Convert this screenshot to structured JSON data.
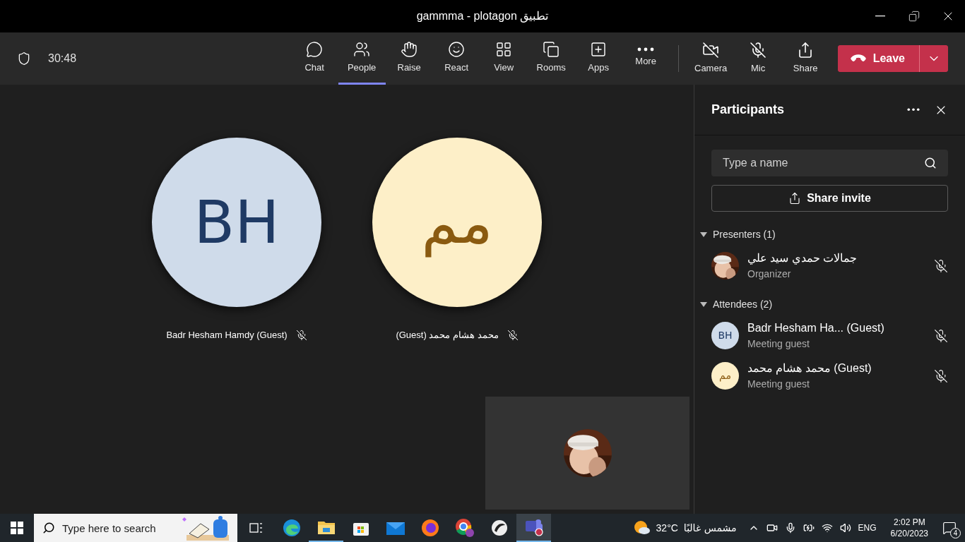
{
  "window": {
    "title": "gammma - plotagon تطبيق"
  },
  "meeting_bar": {
    "timer": "30:48",
    "items": [
      {
        "label": "Chat",
        "selected": false
      },
      {
        "label": "People",
        "selected": true
      },
      {
        "label": "Raise",
        "selected": false
      },
      {
        "label": "React",
        "selected": false
      },
      {
        "label": "View",
        "selected": false
      },
      {
        "label": "Rooms",
        "selected": false
      },
      {
        "label": "Apps",
        "selected": false
      },
      {
        "label": "More",
        "selected": false
      }
    ],
    "devices": [
      {
        "label": "Camera"
      },
      {
        "label": "Mic"
      },
      {
        "label": "Share"
      }
    ],
    "leave_button": "Leave"
  },
  "stage": {
    "tiles": [
      {
        "initials": "BH",
        "name": "Badr Hesham Hamdy (Guest)",
        "color": "#cfdbea"
      },
      {
        "initials": "مم",
        "name": "(Guest) محمد هشام محمد",
        "color": "#fdefc8"
      }
    ]
  },
  "participants_panel": {
    "title": "Participants",
    "search": {
      "placeholder": "Type a name"
    },
    "share_button": "Share invite",
    "groups": [
      {
        "title": "Presenters (1)",
        "expanded": true,
        "people": [
          {
            "kind": "picture",
            "name": "جمالات حمدي سيد علي",
            "role": "Organizer"
          }
        ]
      },
      {
        "title": "Attendees (2)",
        "expanded": true,
        "people": [
          {
            "kind": "initials",
            "initials": "BH",
            "color": "#cfdbea",
            "name": "Badr Hesham Ha... (Guest)",
            "role": "Meeting guest"
          },
          {
            "kind": "initials",
            "initials": "مم",
            "color": "#fdefc8",
            "name": "محمد هشام محمد (Guest)",
            "role": "Meeting guest"
          }
        ]
      }
    ]
  },
  "taskbar": {
    "search": {
      "placeholder": "Type here to search"
    },
    "weather": {
      "temperature": "32°C",
      "condition": "مشمس غالبًا"
    },
    "language": "ENG",
    "time": "2:02 PM",
    "date": "6/20/2023",
    "notification_count": "4"
  }
}
